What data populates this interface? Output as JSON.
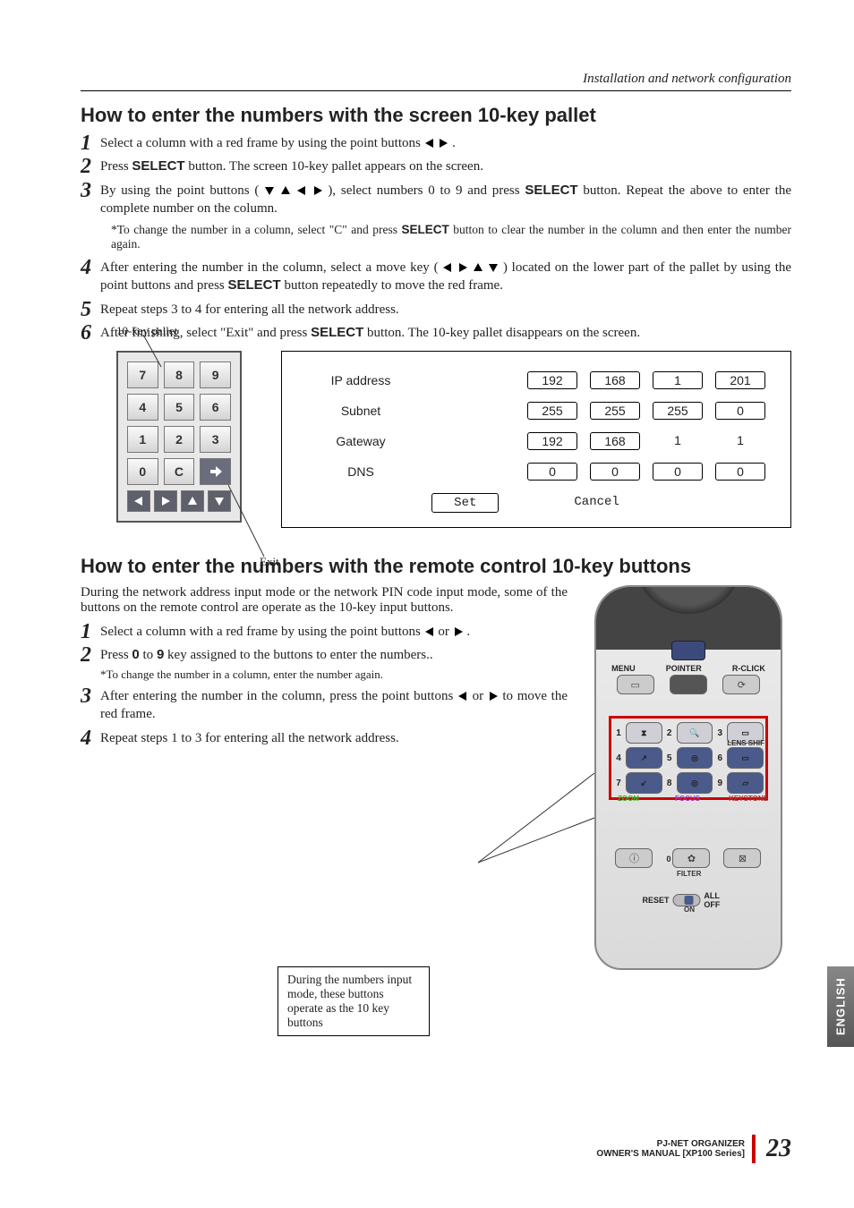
{
  "header": {
    "section": "Installation and network configuration"
  },
  "h1": "How to enter the numbers with the screen 10-key pallet",
  "steps1": {
    "s1a": "Select a column with a red frame by using the point buttons ",
    "s1b": " .",
    "s2a": "Press ",
    "s2b": " button. The screen 10-key pallet appears on the screen.",
    "s3a": "By using the point buttons (",
    "s3b": "), select numbers 0 to 9 and press ",
    "s3c": " button. Repeat the above to enter the complete number on the column.",
    "note1a": "*To change the number in a column, select \"C\" and press ",
    "note1b": " button to clear the number in the column and then enter the number again.",
    "s4a": "After entering the number in the column, select a move key (",
    "s4b": ") located on the lower part of the pallet by using the point buttons and press ",
    "s4c": " button repeatedly to move the red frame.",
    "s5": "Repeat steps 3 to 4 for entering all the network address.",
    "s6a": "After finishing, select \"Exit\" and press ",
    "s6b": " button. The 10-key pallet disappears on the screen."
  },
  "select_label": "SELECT",
  "fig1": {
    "label": "10-key pallet",
    "exit_label": "Exit",
    "keys": [
      "7",
      "8",
      "9",
      "4",
      "5",
      "6",
      "1",
      "2",
      "3",
      "0",
      "C"
    ]
  },
  "net": {
    "rows": [
      {
        "label": "IP address",
        "vals": [
          "192",
          "168",
          "1",
          "201"
        ],
        "boxed": true
      },
      {
        "label": "Subnet",
        "vals": [
          "255",
          "255",
          "255",
          "0"
        ],
        "boxed": true
      },
      {
        "label": "Gateway",
        "vals": [
          "192",
          "168",
          "1",
          "1"
        ],
        "boxed": false
      },
      {
        "label": "DNS",
        "vals": [
          "0",
          "0",
          "0",
          "0"
        ],
        "boxed": true
      }
    ],
    "set": "Set",
    "cancel": "Cancel"
  },
  "h2": "How to enter the numbers with the remote control 10-key buttons",
  "intro2": "During the network address input mode or the network PIN code input mode, some of the buttons on the remote control are operate as the 10-key input buttons.",
  "steps2": {
    "s1a": "Select a column with a red frame by using the point buttons ",
    "s1b": " or ",
    "s1c": " .",
    "s2a": "Press ",
    "s2b": " to ",
    "s2c": " key assigned to the buttons to enter the numbers..",
    "s2note": "*To change the number in a column,  enter the number again.",
    "s3a": "After entering the number in the column, press the point buttons ",
    "s3b": " or ",
    "s3c": " to move the red frame.",
    "s4": "Repeat steps 1 to 3 for entering all the network address."
  },
  "zero": "0",
  "nine": "9",
  "callout": "During the numbers input mode, these buttons operate as the 10 key buttons",
  "remote": {
    "row1": [
      "MENU",
      "POINTER",
      "R-CLICK"
    ],
    "sub": {
      "lens": "LENS SHIF",
      "zoom": "ZOOM",
      "focus": "FOCUS",
      "keystone": "KEYSTONE",
      "filter": "FILTER"
    },
    "reset": "RESET",
    "alloff": "ALL OFF",
    "on": "ON"
  },
  "side": "ENGLISH",
  "footer": {
    "line1": "PJ-NET ORGANIZER",
    "line2": "OWNER'S MANUAL [XP100 Series]",
    "page": "23"
  }
}
